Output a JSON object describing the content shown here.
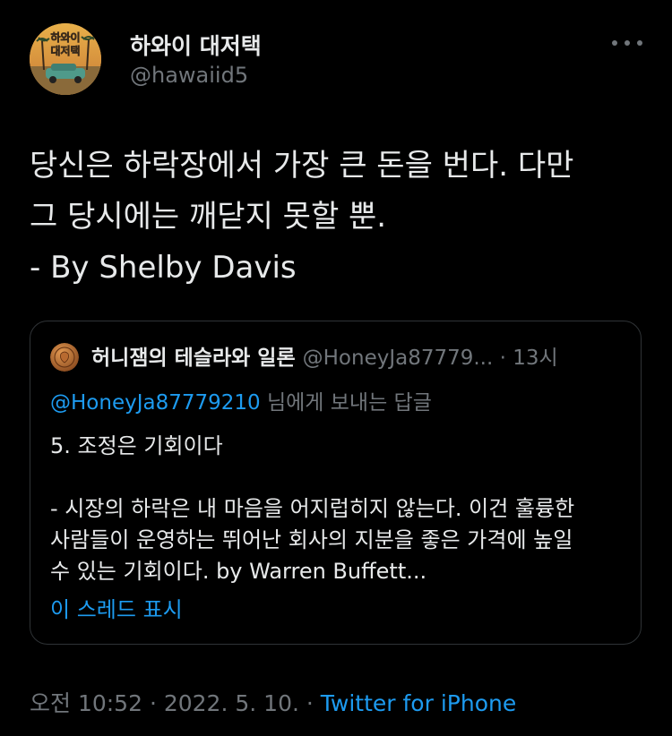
{
  "author": {
    "name": "하와이 대저택",
    "handle": "@hawaiid5",
    "avatar_text_line1": "하와이",
    "avatar_text_line2": "대저택"
  },
  "tweet": {
    "lines": [
      "당신은 하락장에서 가장 큰 돈을 번다. 다만",
      "그 당시에는 깨닫지 못할 뿐.",
      "- By Shelby Davis"
    ]
  },
  "quoted": {
    "name": "허니잼의 테슬라와 일론",
    "handle": "@HoneyJa87779...",
    "separator": "·",
    "time": "13시",
    "reply_mention": "@HoneyJa87779210",
    "reply_suffix": " 님에게 보내는 답글",
    "body_lines": [
      "5. 조정은 기회이다",
      "",
      "- 시장의 하락은 내 마음을 어지럽히지 않는다. 이건 훌륭한",
      "사람들이 운영하는 뛰어난 회사의 지분을 좋은 가격에 높일",
      "수 있는 기회이다. by Warren Buffett..."
    ],
    "show_thread": "이 스레드 표시"
  },
  "meta": {
    "time": "오전 10:52",
    "sep1": " · ",
    "date": "2022. 5. 10.",
    "sep2": " · ",
    "source": "Twitter for iPhone"
  },
  "colors": {
    "background": "#000000",
    "text": "#e7e9ea",
    "secondary": "#71767b",
    "link": "#1d9bf0",
    "border": "#2f3336"
  },
  "icons": {
    "more": "more-horizontal-icon"
  }
}
